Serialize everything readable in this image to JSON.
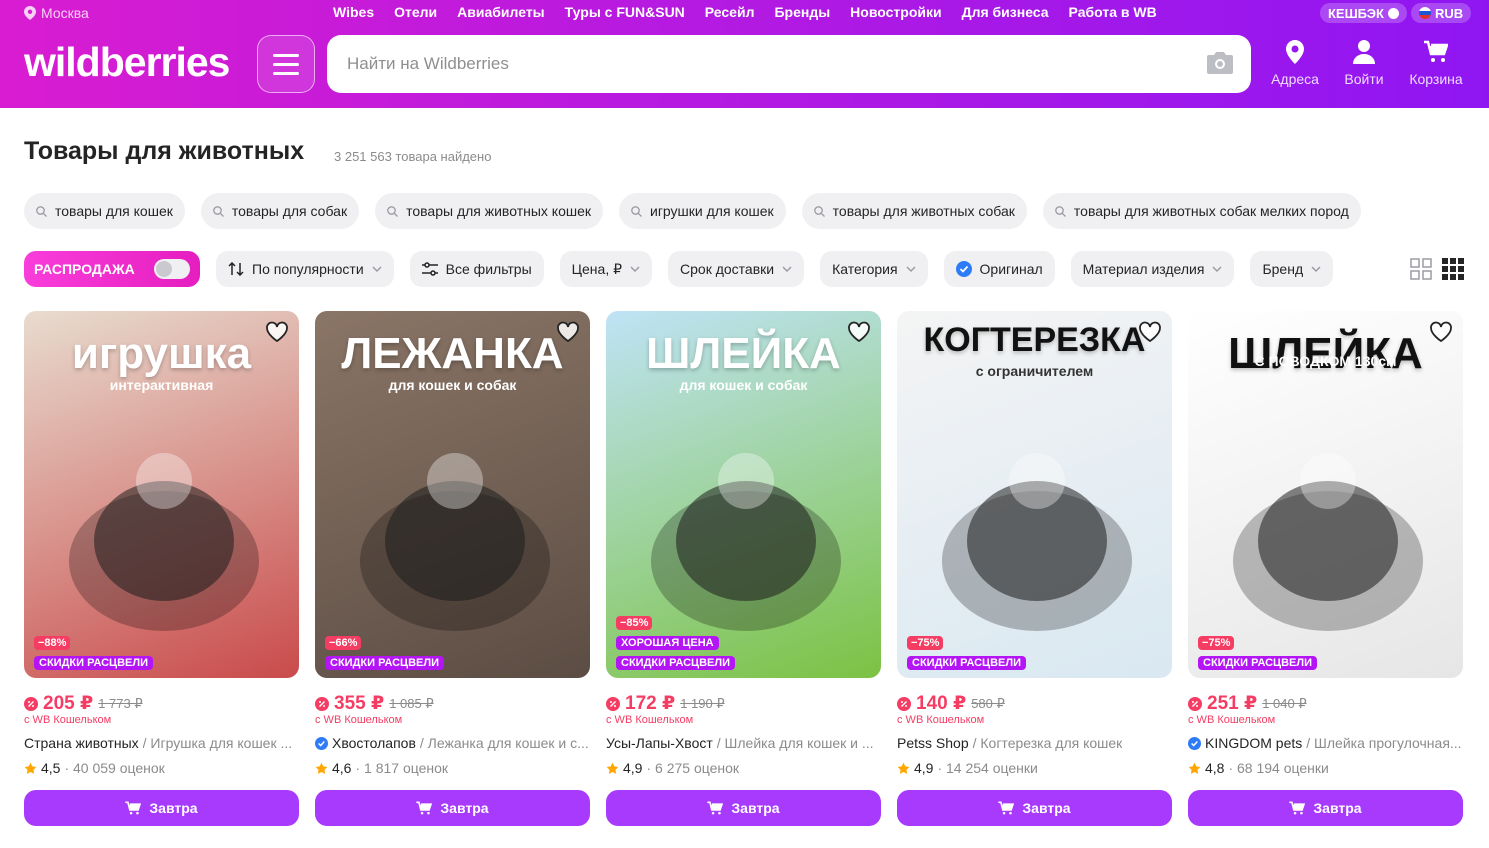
{
  "header": {
    "city": "Москва",
    "nav": [
      "Wibes",
      "Отели",
      "Авиабилеты",
      "Туры с FUN&SUN",
      "Ресейл",
      "Бренды",
      "Новостройки",
      "Для бизнеса",
      "Работа в WB"
    ],
    "cashback": "КЕШБЭК",
    "currency": "RUB",
    "logo": "wildberries",
    "search_placeholder": "Найти на Wildberries",
    "address": "Адреса",
    "login": "Войти",
    "cart": "Корзина"
  },
  "page": {
    "title": "Товары для животных",
    "count": "3 251 563 товара найдено"
  },
  "suggestions": [
    "товары для кошек",
    "товары для собак",
    "товары для животных кошек",
    "игрушки для кошек",
    "товары для животных собак",
    "товары для животных собак мелких пород"
  ],
  "filters": {
    "sale": "РАСПРОДАЖА",
    "sort": "По популярности",
    "all": "Все фильтры",
    "price": "Цена, ₽",
    "delivery": "Срок доставки",
    "category": "Категория",
    "original": "Оригинал",
    "material": "Материал изделия",
    "brand": "Бренд"
  },
  "products": [
    {
      "img_title": "игрушка",
      "img_sub": "интерактивная",
      "discount": "−88%",
      "good": "",
      "deal": "СКИДКИ РАСЦВЕЛИ",
      "price": "205 ₽",
      "old": "1 773 ₽",
      "wallet": "с WB Кошельком",
      "brand": "Страна животных",
      "name": "/ Игрушка для кошек ...",
      "verified": false,
      "rating": "4,5",
      "reviews": "· 40 059 оценок",
      "button": "Завтра",
      "color1": "#e8dccf",
      "color2": "#c94b4b"
    },
    {
      "img_title": "ЛЕЖАНКА",
      "img_sub": "для кошек и собак",
      "discount": "−66%",
      "good": "",
      "deal": "СКИДКИ РАСЦВЕЛИ",
      "price": "355 ₽",
      "old": "1 085 ₽",
      "wallet": "с WB Кошельком",
      "brand": "Хвостолапов",
      "name": "/ Лежанка для кошек и с...",
      "verified": true,
      "rating": "4,6",
      "reviews": "· 1 817 оценок",
      "button": "Завтра",
      "color1": "#8a7566",
      "color2": "#5c4d44"
    },
    {
      "img_title": "ШЛЕЙКА",
      "img_sub": "для кошек и собак",
      "discount": "−85%",
      "good": "ХОРОШАЯ ЦЕНА",
      "deal": "СКИДКИ РАСЦВЕЛИ",
      "price": "172 ₽",
      "old": "1 190 ₽",
      "wallet": "с WB Кошельком",
      "brand": "Усы-Лапы-Хвост",
      "name": "/ Шлейка для кошек и ...",
      "verified": false,
      "rating": "4,9",
      "reviews": "· 6 275 оценок",
      "button": "Завтра",
      "color1": "#bfe3f6",
      "color2": "#7cc243"
    },
    {
      "img_title": "КОГТЕРЕЗКА",
      "img_sub": "с ограничителем",
      "discount": "−75%",
      "good": "",
      "deal": "СКИДКИ РАСЦВЕЛИ",
      "price": "140 ₽",
      "old": "580 ₽",
      "wallet": "с WB Кошельком",
      "brand": "Petss Shop",
      "name": "/ Когтерезка для кошек",
      "verified": false,
      "rating": "4,9",
      "reviews": "· 14 254 оценки",
      "button": "Завтра",
      "color1": "#f4f4f4",
      "color2": "#d9e8f2"
    },
    {
      "img_title": "ШЛЕЙКА",
      "img_sub": "С ПОВОДКОМ 130см",
      "discount": "−75%",
      "good": "",
      "deal": "СКИДКИ РАСЦВЕЛИ",
      "price": "251 ₽",
      "old": "1 040 ₽",
      "wallet": "с WB Кошельком",
      "brand": "KINGDOM pets",
      "name": "/ Шлейка прогулочная...",
      "verified": true,
      "rating": "4,8",
      "reviews": "· 68 194 оценки",
      "button": "Завтра",
      "color1": "#ffffff",
      "color2": "#e6e6e6"
    }
  ],
  "colors": {
    "accent": "#a73afd",
    "sale": "#f53d64",
    "brand_gradient": [
      "#d91cd1",
      "#8f16f2"
    ]
  }
}
